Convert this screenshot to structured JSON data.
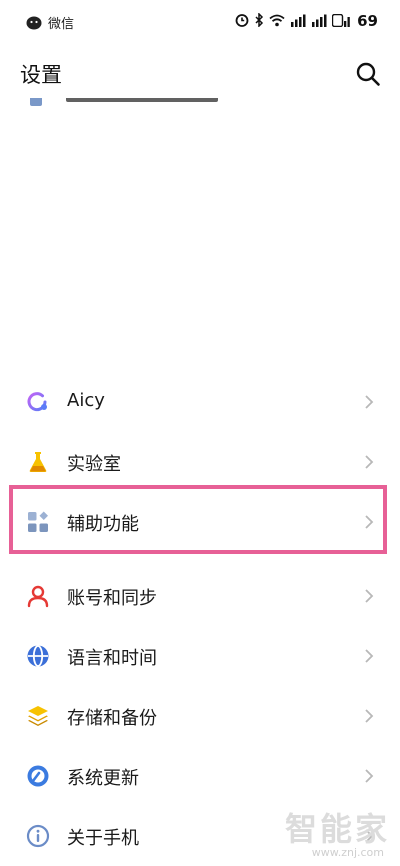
{
  "status_bar": {
    "app_label": "微信",
    "battery": "69"
  },
  "header": {
    "title": "设置"
  },
  "settings_items": [
    {
      "label": "Aicy",
      "icon": "aicy-icon",
      "color": "#8b5cf6"
    },
    {
      "label": "实验室",
      "icon": "flask-icon",
      "color": "#f5b400"
    },
    {
      "label": "辅助功能",
      "icon": "accessibility-grid-icon",
      "color": "#8aa3c8"
    },
    {
      "label": "账号和同步",
      "icon": "account-icon",
      "color": "#e53935"
    },
    {
      "label": "语言和时间",
      "icon": "globe-icon",
      "color": "#3b6fd8"
    },
    {
      "label": "存储和备份",
      "icon": "storage-layers-icon",
      "color": "#f5b400"
    },
    {
      "label": "系统更新",
      "icon": "system-update-icon",
      "color": "#3b7be0"
    },
    {
      "label": "关于手机",
      "icon": "info-icon",
      "color": "#6b8cc7"
    }
  ],
  "highlight_color": "#e76096",
  "watermark": {
    "main": "智能家",
    "sub": "www.znj.com"
  }
}
